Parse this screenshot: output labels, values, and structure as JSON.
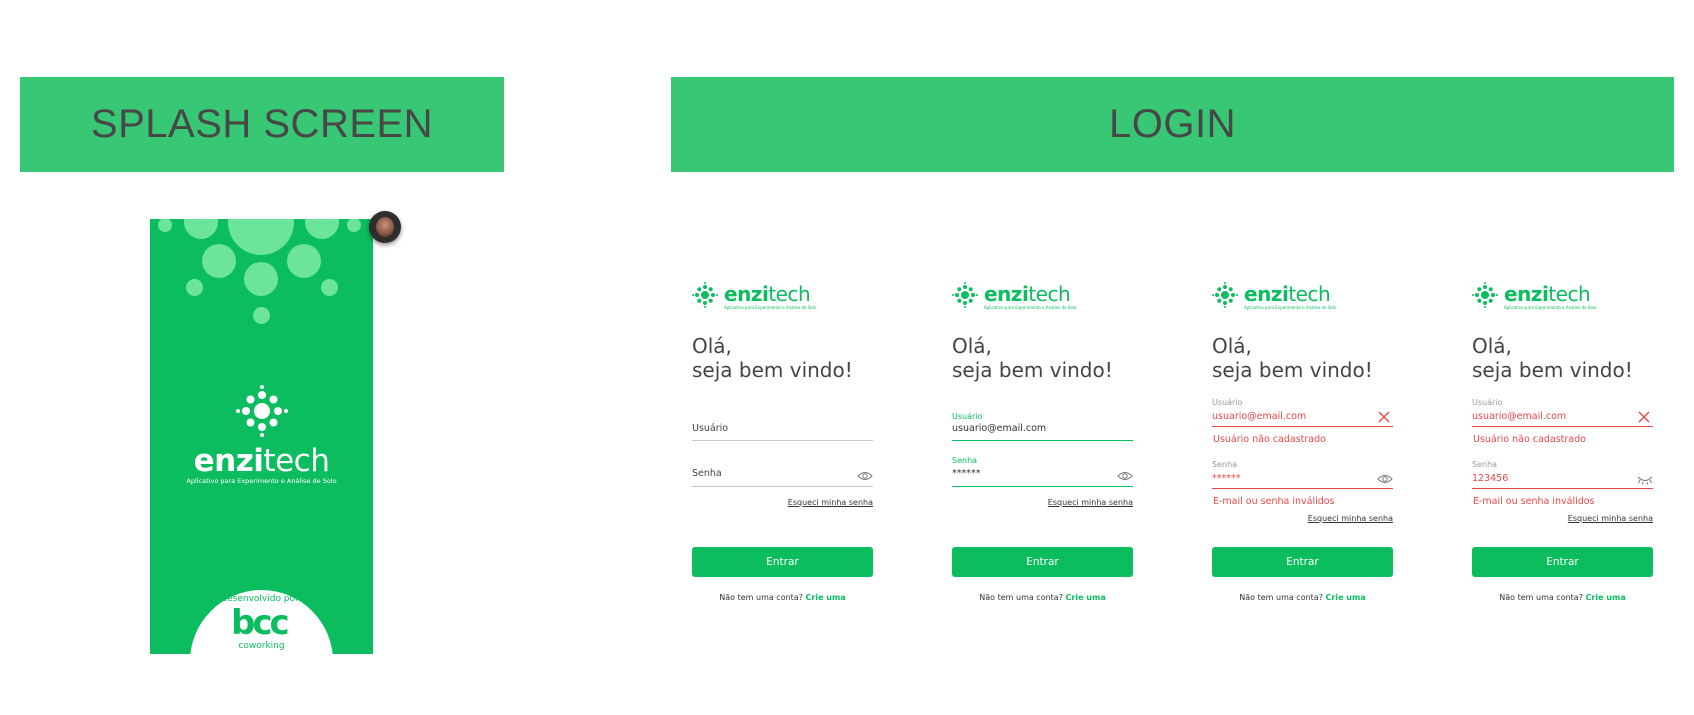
{
  "banners": {
    "splash": "SPLASH SCREEN",
    "login": "LOGIN"
  },
  "colors": {
    "accent": "#0bbd5f",
    "banner": "#38c774",
    "error": "#e44949",
    "bubble": "#6ce49b"
  },
  "splash": {
    "brand_bold": "enzi",
    "brand_light": "tech",
    "tagline": "Aplicativo para Experimento e Análise de Solo",
    "developed_by": "desenvolvido por:",
    "partner_logo": "bcc",
    "partner_sub": "coworking"
  },
  "login": {
    "brand_bold": "enzi",
    "brand_light": "tech",
    "brand_tagline": "Aplicativo para Experimento e Análise de Solo",
    "greeting_1": "Olá,",
    "greeting_2": "seja bem vindo!",
    "forgot": "Esqueci minha senha",
    "enter": "Entrar",
    "signup_text": "Não tem uma conta?",
    "signup_link": "Crie uma",
    "screen1": {
      "user_placeholder": "Usuário",
      "pass_placeholder": "Senha"
    },
    "screen2": {
      "user_label": "Usuário",
      "user_value": "usuario@email.com",
      "pass_label": "Senha",
      "pass_value": "******"
    },
    "screen3": {
      "user_label": "Usuário",
      "user_value": "usuario@email.com",
      "user_error": "Usuário não cadastrado",
      "pass_label": "Senha",
      "pass_value": "******",
      "pass_error": "E-mail ou senha inválidos"
    },
    "screen4": {
      "user_label": "Usuário",
      "user_value": "usuario@email.com",
      "user_error": "Usuário não cadastrado",
      "pass_label": "Senha",
      "pass_value": "123456",
      "pass_error": "E-mail ou senha inválidos"
    }
  }
}
